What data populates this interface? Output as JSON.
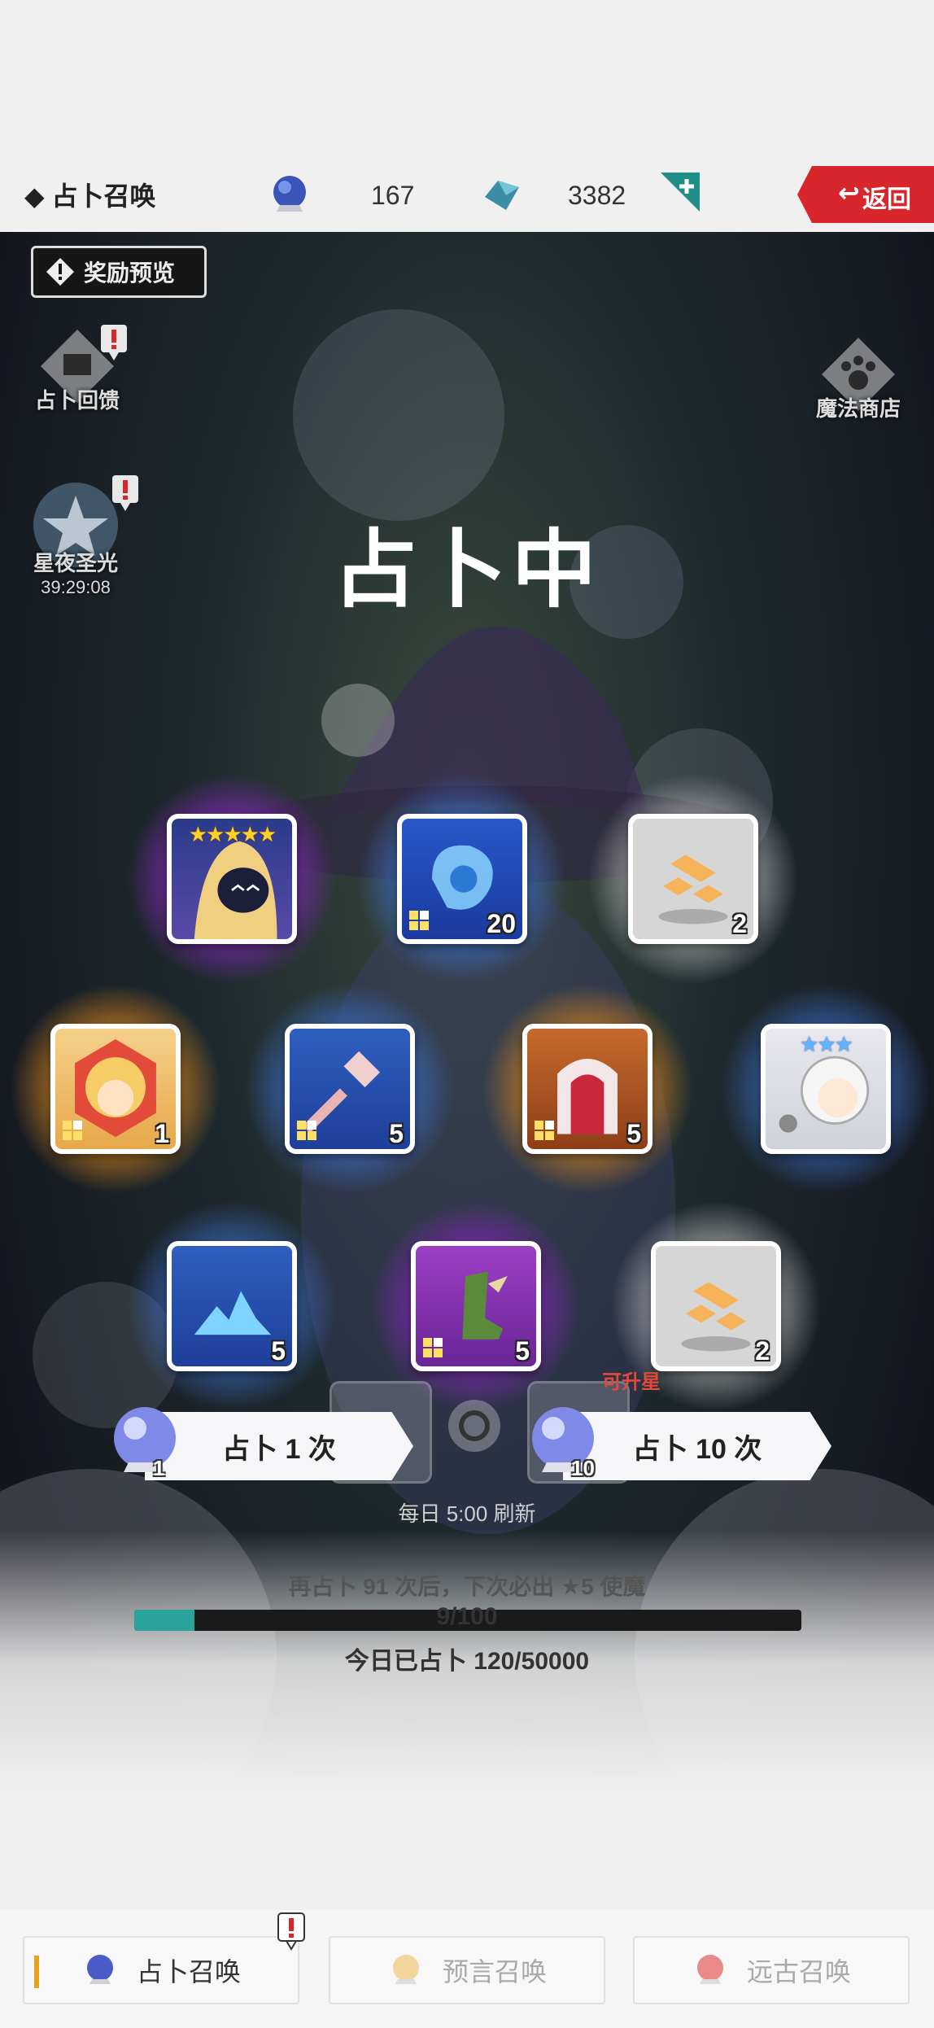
{
  "header": {
    "title": "◆ 占卜召唤",
    "crystal_count": "167",
    "gem_count": "3382",
    "back_label": "返回"
  },
  "stage": {
    "reward_preview_label": "奖励预览",
    "feedback_label": "占卜回馈",
    "star_night_label": "星夜圣光",
    "star_night_timer": "39:29:08",
    "magic_shop_label": "魔法商店",
    "status_text": "占卜中",
    "refresh_text": "每日 5:00 刷新",
    "mini_badge": "可升星"
  },
  "results": [
    {
      "name": "hooded-hero-5star",
      "stars": "★★★★★",
      "count": ""
    },
    {
      "name": "blue-orb-material",
      "count": "20"
    },
    {
      "name": "gold-cube-material",
      "count": "2"
    },
    {
      "name": "golden-knight-fragment",
      "count": "1"
    },
    {
      "name": "pink-mace-item",
      "count": "5"
    },
    {
      "name": "red-shrine-item",
      "count": "5"
    },
    {
      "name": "white-hair-hero-3star",
      "stars": "★★★",
      "count": ""
    },
    {
      "name": "blue-crystal-material",
      "count": "5"
    },
    {
      "name": "green-boot-item",
      "count": "5"
    },
    {
      "name": "gold-cube-material-2",
      "count": "2"
    }
  ],
  "actions": {
    "divine_once_label": "占卜 1 次",
    "divine_once_cost": "1",
    "divine_ten_label": "占卜 10 次",
    "divine_ten_cost": "10"
  },
  "progress": {
    "pity_text": "再占卜 91 次后，下次必出 ★5 使魔",
    "value_text": "9/100",
    "fraction": 0.09,
    "today_text": "今日已占卜 120/50000"
  },
  "tabs": [
    {
      "label": "占卜召唤",
      "active": true
    },
    {
      "label": "预言召唤",
      "active": false
    },
    {
      "label": "远古召唤",
      "active": false
    }
  ],
  "colors": {
    "accent_teal": "#2aa39a",
    "back_red": "#d7262c",
    "star_gold": "#ffcf2a"
  }
}
